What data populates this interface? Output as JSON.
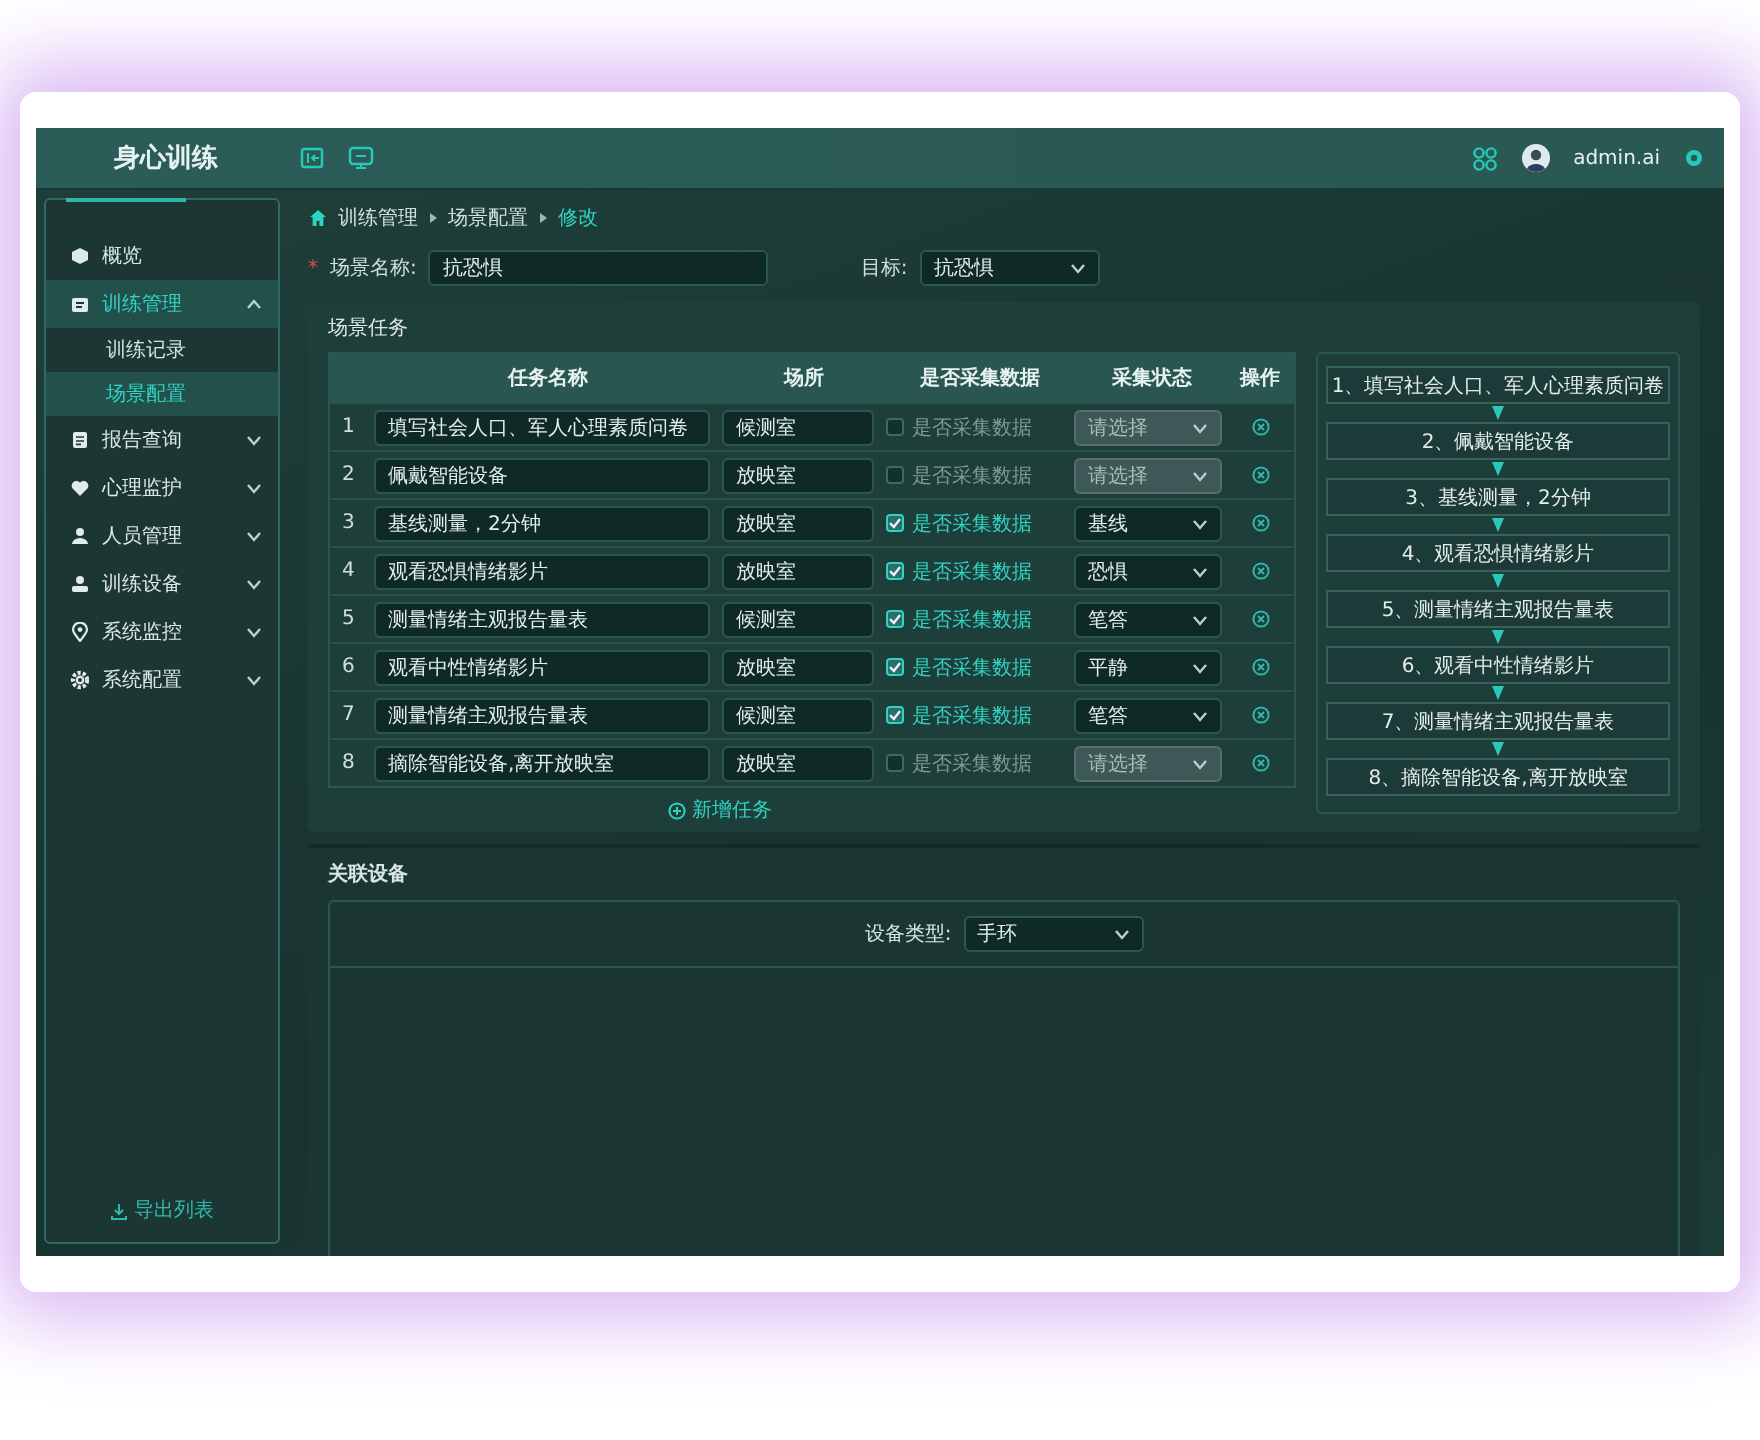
{
  "header": {
    "title": "身心训练",
    "user": "admin.ai"
  },
  "sidebar": {
    "items": [
      {
        "label": "概览",
        "selected": false
      },
      {
        "label": "训练管理",
        "selected": true,
        "expanded": true,
        "children": [
          {
            "label": "训练记录",
            "selected": false
          },
          {
            "label": "场景配置",
            "selected": true
          }
        ]
      },
      {
        "label": "报告查询",
        "selected": false,
        "expanded": false
      },
      {
        "label": "心理监护",
        "selected": false,
        "expanded": false
      },
      {
        "label": "人员管理",
        "selected": false,
        "expanded": false
      },
      {
        "label": "训练设备",
        "selected": false,
        "expanded": false
      },
      {
        "label": "系统监控",
        "selected": false,
        "expanded": false
      },
      {
        "label": "系统配置",
        "selected": false,
        "expanded": false
      }
    ],
    "export": "导出列表"
  },
  "breadcrumb": [
    "训练管理",
    "场景配置",
    "修改"
  ],
  "form": {
    "required_mark": "*",
    "name_label": "场景名称:",
    "name_value": "抗恐惧",
    "target_label": "目标:",
    "target_value": "抗恐惧"
  },
  "tasks": {
    "title": "场景任务",
    "columns": [
      "任务名称",
      "场所",
      "是否采集数据",
      "采集状态",
      "操作"
    ],
    "rows": [
      {
        "index": "1",
        "name": "填写社会人口、军人心理素质问卷",
        "site": "候测室",
        "collect": false,
        "collect_label": "是否采集数据",
        "status": {
          "placeholder": "请选择",
          "disabled": true
        }
      },
      {
        "index": "2",
        "name": "佩戴智能设备",
        "site": "放映室",
        "collect": false,
        "collect_label": "是否采集数据",
        "status": {
          "placeholder": "请选择",
          "disabled": true
        }
      },
      {
        "index": "3",
        "name": "基线测量，2分钟",
        "site": "放映室",
        "collect": true,
        "collect_label": "是否采集数据",
        "status": {
          "value": "基线",
          "disabled": false
        }
      },
      {
        "index": "4",
        "name": "观看恐惧情绪影片",
        "site": "放映室",
        "collect": true,
        "collect_label": "是否采集数据",
        "status": {
          "value": "恐惧",
          "disabled": false
        }
      },
      {
        "index": "5",
        "name": "测量情绪主观报告量表",
        "site": "候测室",
        "collect": true,
        "collect_label": "是否采集数据",
        "status": {
          "value": "笔答",
          "disabled": false
        }
      },
      {
        "index": "6",
        "name": "观看中性情绪影片",
        "site": "放映室",
        "collect": true,
        "collect_label": "是否采集数据",
        "status": {
          "value": "平静",
          "disabled": false
        }
      },
      {
        "index": "7",
        "name": "测量情绪主观报告量表",
        "site": "候测室",
        "collect": true,
        "collect_label": "是否采集数据",
        "status": {
          "value": "笔答",
          "disabled": false
        }
      },
      {
        "index": "8",
        "name": "摘除智能设备,离开放映室",
        "site": "放映室",
        "collect": false,
        "collect_label": "是否采集数据",
        "status": {
          "placeholder": "请选择",
          "disabled": true
        }
      }
    ],
    "add": "新增任务"
  },
  "flow": {
    "steps": [
      "1、填写社会人口、军人心理素质问卷",
      "2、佩戴智能设备",
      "3、基线测量，2分钟",
      "4、观看恐惧情绪影片",
      "5、测量情绪主观报告量表",
      "6、观看中性情绪影片",
      "7、测量情绪主观报告量表",
      "8、摘除智能设备,离开放映室"
    ]
  },
  "devices": {
    "title": "关联设备",
    "type_label": "设备类型:",
    "type_value": "手环"
  }
}
